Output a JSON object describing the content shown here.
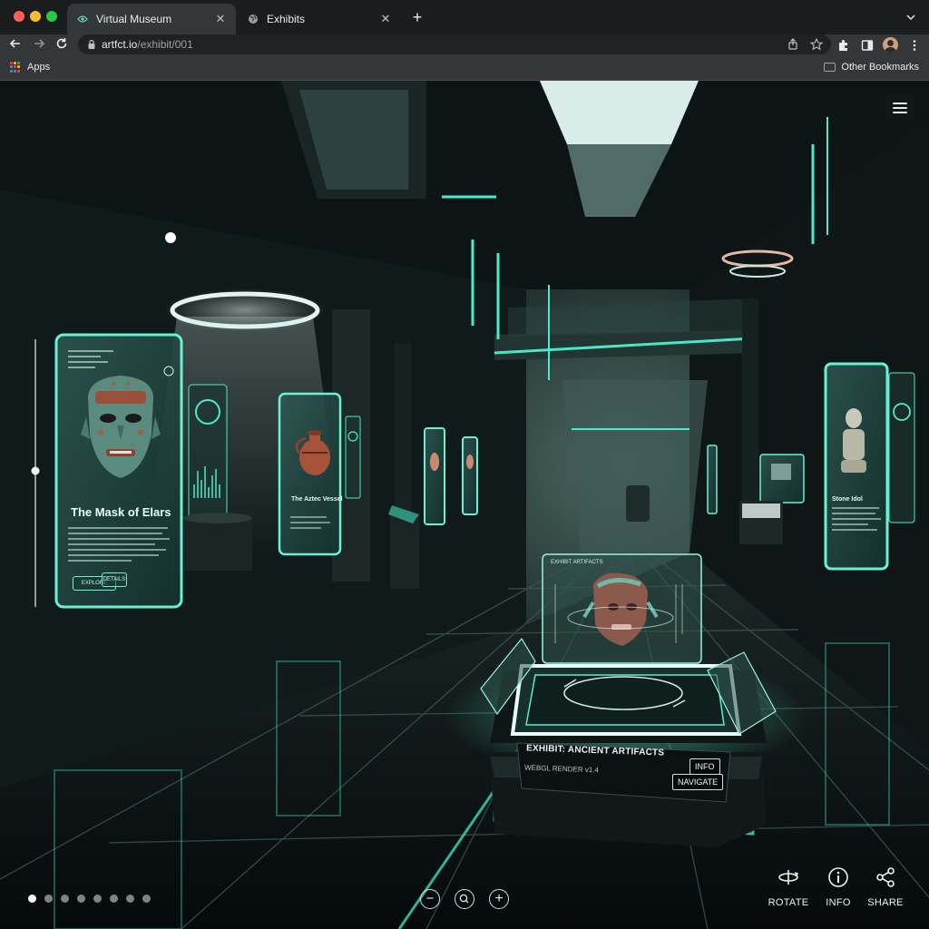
{
  "browser": {
    "tabs": [
      {
        "title": "Virtual Museum",
        "active": true,
        "favicon": "museum-icon"
      },
      {
        "title": "Exhibits",
        "active": false,
        "favicon": "globe-icon"
      }
    ],
    "new_tab_label": "+",
    "url": {
      "host": "artfct.io",
      "path": "/exhibit/001"
    },
    "bookmarks": {
      "apps_label": "Apps",
      "other_label": "Other Bookmarks"
    }
  },
  "exhibit": {
    "left_panel": {
      "title": "The Mask of Elars",
      "buttons": [
        "EXPLORE",
        "DETAILS"
      ]
    },
    "side_panel_title": "The Aztec Vessel",
    "right_panel_title": "Stone Idol",
    "hologram_header": "EXHIBIT ARTIFACTS",
    "pedestal": {
      "label": "EXHIBIT: ANCIENT ARTIFACTS",
      "subtitle": "WEBGL RENDER v1.4",
      "info_button": "INFO",
      "navigate_button": "NAVIGATE"
    },
    "pagination": {
      "count": 8,
      "active_index": 0
    },
    "zoom_controls": {
      "zoom_out": "−",
      "reset": "⌕",
      "zoom_in": "+"
    },
    "actions": [
      {
        "label": "ROTATE",
        "icon": "rotate-icon"
      },
      {
        "label": "INFO",
        "icon": "info-icon"
      },
      {
        "label": "SHARE",
        "icon": "share-icon"
      }
    ]
  },
  "colors": {
    "accent": "#3ef0c9",
    "glass": "#7fe9d4"
  }
}
